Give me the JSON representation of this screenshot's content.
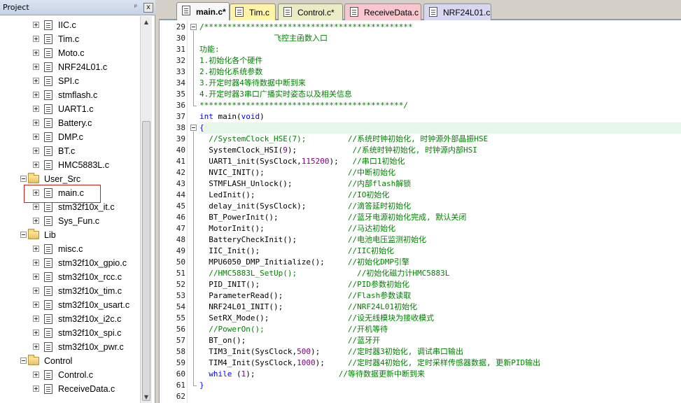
{
  "project_panel": {
    "title": "Project",
    "pin": "ᵖ",
    "close": "x",
    "tree": [
      {
        "type": "file",
        "label": "IIC.c",
        "depth": 2
      },
      {
        "type": "file",
        "label": "Tim.c",
        "depth": 2
      },
      {
        "type": "file",
        "label": "Moto.c",
        "depth": 2
      },
      {
        "type": "file",
        "label": "NRF24L01.c",
        "depth": 2
      },
      {
        "type": "file",
        "label": "SPI.c",
        "depth": 2
      },
      {
        "type": "file",
        "label": "stmflash.c",
        "depth": 2
      },
      {
        "type": "file",
        "label": "UART1.c",
        "depth": 2
      },
      {
        "type": "file",
        "label": "Battery.c",
        "depth": 2
      },
      {
        "type": "file",
        "label": "DMP.c",
        "depth": 2
      },
      {
        "type": "file",
        "label": "BT.c",
        "depth": 2
      },
      {
        "type": "file",
        "label": "HMC5883L.c",
        "depth": 2
      },
      {
        "type": "folder",
        "label": "User_Src",
        "depth": 1
      },
      {
        "type": "file",
        "label": "main.c",
        "depth": 2,
        "highlighted": true
      },
      {
        "type": "file",
        "label": "stm32f10x_it.c",
        "depth": 2
      },
      {
        "type": "file",
        "label": "Sys_Fun.c",
        "depth": 2
      },
      {
        "type": "folder",
        "label": "Lib",
        "depth": 1
      },
      {
        "type": "file",
        "label": "misc.c",
        "depth": 2
      },
      {
        "type": "file",
        "label": "stm32f10x_gpio.c",
        "depth": 2
      },
      {
        "type": "file",
        "label": "stm32f10x_rcc.c",
        "depth": 2
      },
      {
        "type": "file",
        "label": "stm32f10x_tim.c",
        "depth": 2
      },
      {
        "type": "file",
        "label": "stm32f10x_usart.c",
        "depth": 2
      },
      {
        "type": "file",
        "label": "stm32f10x_i2c.c",
        "depth": 2
      },
      {
        "type": "file",
        "label": "stm32f10x_spi.c",
        "depth": 2
      },
      {
        "type": "file",
        "label": "stm32f10x_pwr.c",
        "depth": 2
      },
      {
        "type": "folder",
        "label": "Control",
        "depth": 1
      },
      {
        "type": "file",
        "label": "Control.c",
        "depth": 2
      },
      {
        "type": "file",
        "label": "ReceiveData.c",
        "depth": 2
      }
    ]
  },
  "tabs": [
    {
      "label": "main.c*",
      "color": "#f7f7f7",
      "active": true
    },
    {
      "label": "Tim.c",
      "color": "#fff3a8",
      "active": false
    },
    {
      "label": "Control.c*",
      "color": "#e9ecc4",
      "active": false
    },
    {
      "label": "ReceiveData.c",
      "color": "#f8c6cc",
      "active": false
    },
    {
      "label": "NRF24L01.c",
      "color": "#d6d8f3",
      "active": false
    }
  ],
  "editor": {
    "current_line": 38,
    "lines": [
      {
        "n": "29",
        "parts": [
          {
            "t": "/*********************************************",
            "c": "comment"
          }
        ],
        "fold": true
      },
      {
        "n": "30",
        "parts": [
          {
            "t": "                飞控主函数入口",
            "c": "comment"
          }
        ]
      },
      {
        "n": "31",
        "parts": [
          {
            "t": "功能:",
            "c": "comment"
          }
        ]
      },
      {
        "n": "32",
        "parts": [
          {
            "t": "1.初始化各个硬件",
            "c": "comment"
          }
        ]
      },
      {
        "n": "33",
        "parts": [
          {
            "t": "2.初始化系统参数",
            "c": "comment"
          }
        ]
      },
      {
        "n": "34",
        "parts": [
          {
            "t": "3.开定时器4等待数据中断到来",
            "c": "comment"
          }
        ]
      },
      {
        "n": "35",
        "parts": [
          {
            "t": "4.开定时器3串口广播实时姿态以及相关信息",
            "c": "comment"
          }
        ]
      },
      {
        "n": "36",
        "parts": [
          {
            "t": "********************************************/",
            "c": "comment"
          }
        ]
      },
      {
        "n": "37",
        "parts": [
          {
            "t": "int",
            "c": "keyword"
          },
          {
            "t": " main(",
            "c": ""
          },
          {
            "t": "void",
            "c": "keyword"
          },
          {
            "t": ")",
            "c": ""
          }
        ]
      },
      {
        "n": "38",
        "parts": [
          {
            "t": "{",
            "c": "brace"
          }
        ],
        "fold": true
      },
      {
        "n": "39",
        "parts": [
          {
            "t": "  //SystemClock_HSE(7);         //系统时钟初始化, 时钟源外部晶振HSE",
            "c": "comment"
          }
        ]
      },
      {
        "n": "40",
        "parts": [
          {
            "t": "  SystemClock_HSI(",
            "c": ""
          },
          {
            "t": "9",
            "c": "number"
          },
          {
            "t": ");            ",
            "c": ""
          },
          {
            "t": "//系统时钟初始化, 时钟源内部HSI",
            "c": "comment"
          }
        ]
      },
      {
        "n": "41",
        "parts": [
          {
            "t": "  UART1_init(SysClock,",
            "c": ""
          },
          {
            "t": "115200",
            "c": "number"
          },
          {
            "t": ");   ",
            "c": ""
          },
          {
            "t": "//串口1初始化",
            "c": "comment"
          }
        ]
      },
      {
        "n": "42",
        "parts": [
          {
            "t": "  NVIC_INIT();                  ",
            "c": ""
          },
          {
            "t": "//中断初始化",
            "c": "comment"
          }
        ]
      },
      {
        "n": "43",
        "parts": [
          {
            "t": "  STMFLASH_Unlock();            ",
            "c": ""
          },
          {
            "t": "//内部flash解锁",
            "c": "comment"
          }
        ]
      },
      {
        "n": "44",
        "parts": [
          {
            "t": "  LedInit();                    ",
            "c": ""
          },
          {
            "t": "//IO初始化",
            "c": "comment"
          }
        ]
      },
      {
        "n": "45",
        "parts": [
          {
            "t": "  delay_init(SysClock);         ",
            "c": ""
          },
          {
            "t": "//滴答延时初始化",
            "c": "comment"
          }
        ]
      },
      {
        "n": "46",
        "parts": [
          {
            "t": "  BT_PowerInit();               ",
            "c": ""
          },
          {
            "t": "//蓝牙电源初始化完成, 默认关闭",
            "c": "comment"
          }
        ]
      },
      {
        "n": "47",
        "parts": [
          {
            "t": "  MotorInit();                  ",
            "c": ""
          },
          {
            "t": "//马达初始化",
            "c": "comment"
          }
        ]
      },
      {
        "n": "48",
        "parts": [
          {
            "t": "  BatteryCheckInit();           ",
            "c": ""
          },
          {
            "t": "//电池电压监测初始化",
            "c": "comment"
          }
        ]
      },
      {
        "n": "49",
        "parts": [
          {
            "t": "  IIC_Init();                   ",
            "c": ""
          },
          {
            "t": "//IIC初始化",
            "c": "comment"
          }
        ]
      },
      {
        "n": "50",
        "parts": [
          {
            "t": "  MPU6050_DMP_Initialize();     ",
            "c": ""
          },
          {
            "t": "//初始化DMP引擎",
            "c": "comment"
          }
        ]
      },
      {
        "n": "51",
        "parts": [
          {
            "t": "  //HMC5883L_SetUp();             //初始化磁力计HMC5883L",
            "c": "comment"
          }
        ]
      },
      {
        "n": "52",
        "parts": [
          {
            "t": "  PID_INIT();                   ",
            "c": ""
          },
          {
            "t": "//PID参数初始化",
            "c": "comment"
          }
        ]
      },
      {
        "n": "53",
        "parts": [
          {
            "t": "  ParameterRead();              ",
            "c": ""
          },
          {
            "t": "//Flash参数读取",
            "c": "comment"
          }
        ]
      },
      {
        "n": "54",
        "parts": [
          {
            "t": "  NRF24L01_INIT();              ",
            "c": ""
          },
          {
            "t": "//NRF24L01初始化",
            "c": "comment"
          }
        ]
      },
      {
        "n": "55",
        "parts": [
          {
            "t": "  SetRX_Mode();                 ",
            "c": ""
          },
          {
            "t": "//设无线模块为接收模式",
            "c": "comment"
          }
        ]
      },
      {
        "n": "56",
        "parts": [
          {
            "t": "  //PowerOn();                  //开机等待",
            "c": "comment"
          }
        ]
      },
      {
        "n": "57",
        "parts": [
          {
            "t": "  BT_on();                      ",
            "c": ""
          },
          {
            "t": "//蓝牙开",
            "c": "comment"
          }
        ]
      },
      {
        "n": "58",
        "parts": [
          {
            "t": "  TIM3_Init(SysClock,",
            "c": ""
          },
          {
            "t": "500",
            "c": "number"
          },
          {
            "t": ");      ",
            "c": ""
          },
          {
            "t": "//定时器3初始化, 调试串口输出",
            "c": "comment"
          }
        ]
      },
      {
        "n": "59",
        "parts": [
          {
            "t": "  TIM4_Init(SysClock,",
            "c": ""
          },
          {
            "t": "1000",
            "c": "number"
          },
          {
            "t": ");     ",
            "c": ""
          },
          {
            "t": "//定时器4初始化, 定时采样传感器数据, 更新PID输出",
            "c": "comment"
          }
        ]
      },
      {
        "n": "60",
        "parts": [
          {
            "t": "  ",
            "c": ""
          },
          {
            "t": "while",
            "c": "keyword"
          },
          {
            "t": " (",
            "c": ""
          },
          {
            "t": "1",
            "c": "number"
          },
          {
            "t": ");                  ",
            "c": ""
          },
          {
            "t": "//等待数据更新中断到来",
            "c": "comment"
          }
        ]
      },
      {
        "n": "61",
        "parts": [
          {
            "t": "}",
            "c": "brace"
          }
        ],
        "fold_end": true
      },
      {
        "n": "62",
        "parts": []
      }
    ]
  }
}
